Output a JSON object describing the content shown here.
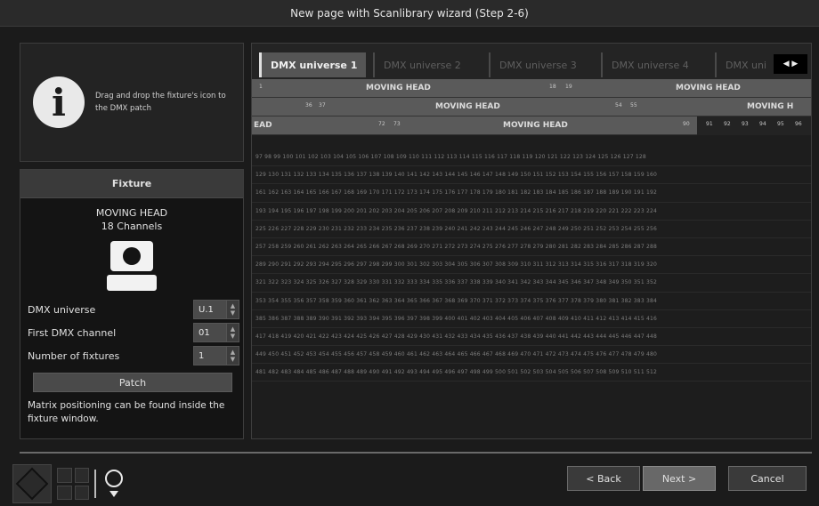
{
  "window": {
    "title": "New page with Scanlibrary wizard (Step 2-6)"
  },
  "info": {
    "text": "Drag and drop the fixture's icon to the DMX patch"
  },
  "fixture_panel": {
    "header": "Fixture",
    "fixture_name": "MOVING HEAD",
    "channels": "18 Channels",
    "fields": {
      "universe_label": "DMX universe",
      "universe_value": "U.1",
      "first_channel_label": "First DMX channel",
      "first_channel_value": "01",
      "num_fixtures_label": "Number of fixtures",
      "num_fixtures_value": "1"
    },
    "patch_button": "Patch",
    "note": "Matrix positioning can be found inside the fixture window."
  },
  "tabs": [
    "DMX universe 1",
    "DMX universe 2",
    "DMX universe 3",
    "DMX universe 4",
    "DMX uni"
  ],
  "patch_rows": [
    {
      "nums": [
        "1",
        "18",
        "19"
      ],
      "labels": [
        "MOVING HEAD",
        "MOVING HEAD"
      ]
    },
    {
      "nums": [
        "36",
        "37",
        "54",
        "55"
      ],
      "labels": [
        "MOVING HEAD",
        "MOVING H"
      ]
    },
    {
      "nums": [
        "72",
        "73",
        "90",
        "91",
        "92",
        "93",
        "94",
        "95",
        "96"
      ],
      "labels": [
        "EAD",
        "MOVING HEAD"
      ]
    }
  ],
  "channel_rows": [
    "97 98 99 100 101 102 103 104 105 106 107 108 109 110 111 112 113 114 115 116 117 118 119 120 121 122 123 124 125 126 127 128",
    "129 130 131 132 133 134 135 136 137 138 139 140 141 142 143 144 145 146 147 148 149 150 151 152 153 154 155 156 157 158 159 160",
    "161 162 163 164 165 166 167 168 169 170 171 172 173 174 175 176 177 178 179 180 181 182 183 184 185 186 187 188 189 190 191 192",
    "193 194 195 196 197 198 199 200 201 202 203 204 205 206 207 208 209 210 211 212 213 214 215 216 217 218 219 220 221 222 223 224",
    "225 226 227 228 229 230 231 232 233 234 235 236 237 238 239 240 241 242 243 244 245 246 247 248 249 250 251 252 253 254 255 256",
    "257 258 259 260 261 262 263 264 265 266 267 268 269 270 271 272 273 274 275 276 277 278 279 280 281 282 283 284 285 286 287 288",
    "289 290 291 292 293 294 295 296 297 298 299 300 301 302 303 304 305 306 307 308 309 310 311 312 313 314 315 316 317 318 319 320",
    "321 322 323 324 325 326 327 328 329 330 331 332 333 334 335 336 337 338 339 340 341 342 343 344 345 346 347 348 349 350 351 352",
    "353 354 355 356 357 358 359 360 361 362 363 364 365 366 367 368 369 370 371 372 373 374 375 376 377 378 379 380 381 382 383 384",
    "385 386 387 388 389 390 391 392 393 394 395 396 397 398 399 400 401 402 403 404 405 406 407 408 409 410 411 412 413 414 415 416",
    "417 418 419 420 421 422 423 424 425 426 427 428 429 430 431 432 433 434 435 436 437 438 439 440 441 442 443 444 445 446 447 448",
    "449 450 451 452 453 454 455 456 457 458 459 460 461 462 463 464 465 466 467 468 469 470 471 472 473 474 475 476 477 478 479 480",
    "481 482 483 484 485 486 487 488 489 490 491 492 493 494 495 496 497 498 499 500 501 502 503 504 505 506 507 508 509 510 511 512"
  ],
  "footer": {
    "back": "< Back",
    "next": "Next >",
    "cancel": "Cancel"
  }
}
